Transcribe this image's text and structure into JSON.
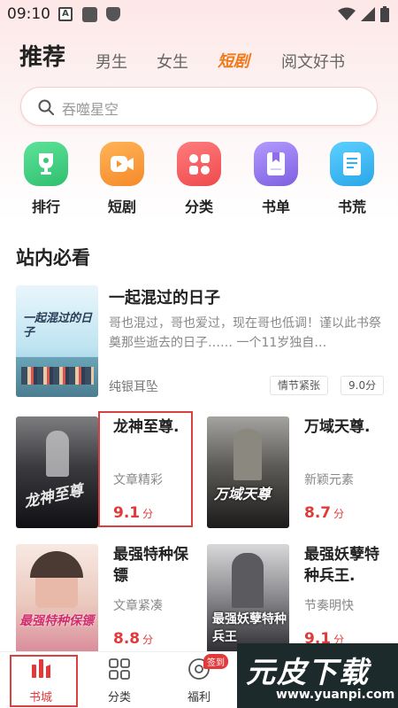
{
  "status_bar": {
    "time": "09:10"
  },
  "tabs": [
    {
      "label": "推荐"
    },
    {
      "label": "男生"
    },
    {
      "label": "女生"
    },
    {
      "label": "短剧"
    },
    {
      "label": "阅文好书"
    }
  ],
  "search": {
    "placeholder": "吞噬星空"
  },
  "categories": [
    {
      "label": "排行",
      "color": "#39c77a"
    },
    {
      "label": "短剧",
      "color": "#f79533"
    },
    {
      "label": "分类",
      "color": "#f2585a"
    },
    {
      "label": "书单",
      "color": "#8e6ee6"
    },
    {
      "label": "书荒",
      "color": "#33b4ee"
    }
  ],
  "section_title": "站内必看",
  "featured": {
    "cover_text": "一起混过的日子",
    "title": "一起混过的日子",
    "desc": "哥也混过，哥也爱过，现在哥也低调！谨以此书祭奠那些逝去的日子…… 一个11岁独自…",
    "author": "纯银耳坠",
    "tag": "情节紧张",
    "score": "9.0分"
  },
  "books": [
    {
      "title": "龙神至尊.",
      "tag": "文章精彩",
      "score": "9.1",
      "unit": "分",
      "cover_text": "龙神至尊"
    },
    {
      "title": "万域天尊.",
      "tag": "新颖元素",
      "score": "8.7",
      "unit": "分",
      "cover_text": "万域天尊"
    },
    {
      "title": "最强特种保镖",
      "tag": "文章紧凑",
      "score": "8.8",
      "unit": "分",
      "cover_text": "最强特种保镖"
    },
    {
      "title": "最强妖孽特种兵王.",
      "tag": "节奏明快",
      "score": "9.1",
      "unit": "分",
      "cover_text": "最强妖孽特种兵王"
    }
  ],
  "bottom_nav": [
    {
      "label": "书城"
    },
    {
      "label": "分类"
    },
    {
      "label": "福利",
      "badge": "签到"
    }
  ],
  "watermark": {
    "big": "元皮下载",
    "small": "www.yuanpi.com"
  },
  "colors": {
    "accent": "#e23a3a",
    "highlight_tab": "#f07a1a"
  }
}
